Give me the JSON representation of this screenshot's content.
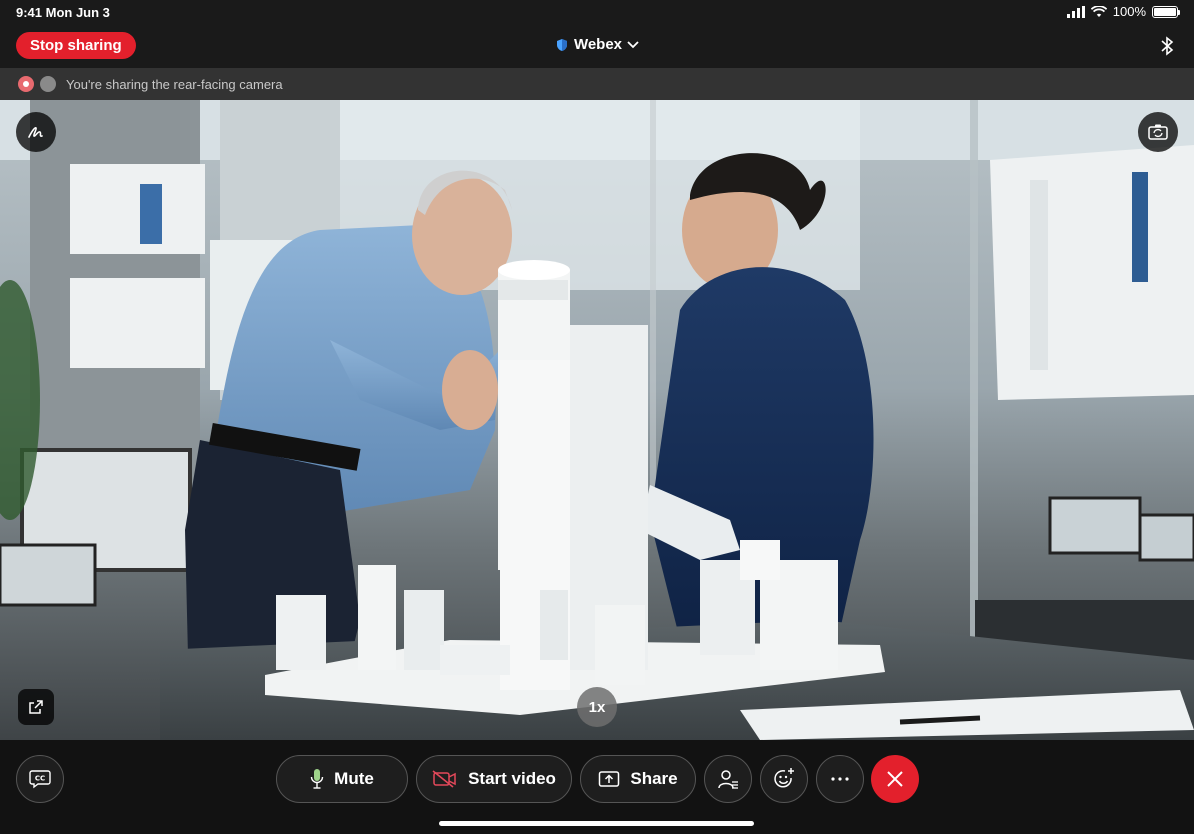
{
  "status_bar": {
    "time_date": "9:41  Mon Jun 3",
    "battery": "100%",
    "battery_level": 1.0
  },
  "top_bar": {
    "stop_label": "Stop sharing",
    "app_title": "Webex"
  },
  "banner": {
    "text": "You're sharing the rear-facing camera"
  },
  "camera": {
    "zoom_label": "1x"
  },
  "controls": {
    "mute_label": "Mute",
    "video_label": "Start video",
    "share_label": "Share"
  },
  "colors": {
    "accent_red": "#e3202c",
    "mic_green": "#9ed38a",
    "video_off_red": "#e3485a"
  }
}
